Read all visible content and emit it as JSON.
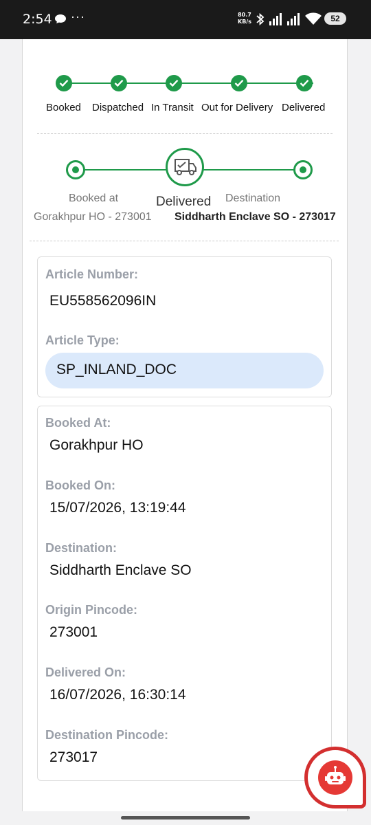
{
  "status_bar": {
    "time": "2:54",
    "more": "···",
    "speed_value": "80.7",
    "speed_unit": "KB/s",
    "battery": "52"
  },
  "tracker": {
    "steps": [
      {
        "label": "Booked",
        "done": true
      },
      {
        "label": "Dispatched",
        "done": true
      },
      {
        "label": "In Transit",
        "done": true
      },
      {
        "label": "Out for Delivery",
        "done": true
      },
      {
        "label": "Delivered",
        "done": true
      }
    ],
    "color": "#1f9a4a"
  },
  "route": {
    "origin_caption": "Booked at",
    "origin_office": "Gorakhpur HO - 273001",
    "status": "Delivered",
    "dest_caption": "Destination",
    "dest_office": "Siddharth Enclave SO - 273017"
  },
  "article": {
    "number_label": "Article Number:",
    "number": "EU558562096IN",
    "type_label": "Article Type:",
    "type": "SP_INLAND_DOC"
  },
  "details": {
    "booked_at_label": "Booked At:",
    "booked_at": "Gorakhpur HO",
    "booked_on_label": "Booked On:",
    "booked_on": "15/07/2026, 13:19:44",
    "destination_label": "Destination:",
    "destination": "Siddharth Enclave SO",
    "origin_pin_label": "Origin Pincode:",
    "origin_pin": "273001",
    "delivered_on_label": "Delivered On:",
    "delivered_on": "16/07/2026, 16:30:14",
    "dest_pin_label": "Destination Pincode:",
    "dest_pin": "273017"
  },
  "chatbot": {
    "icon": "robot-icon",
    "color": "#d32f2f"
  }
}
